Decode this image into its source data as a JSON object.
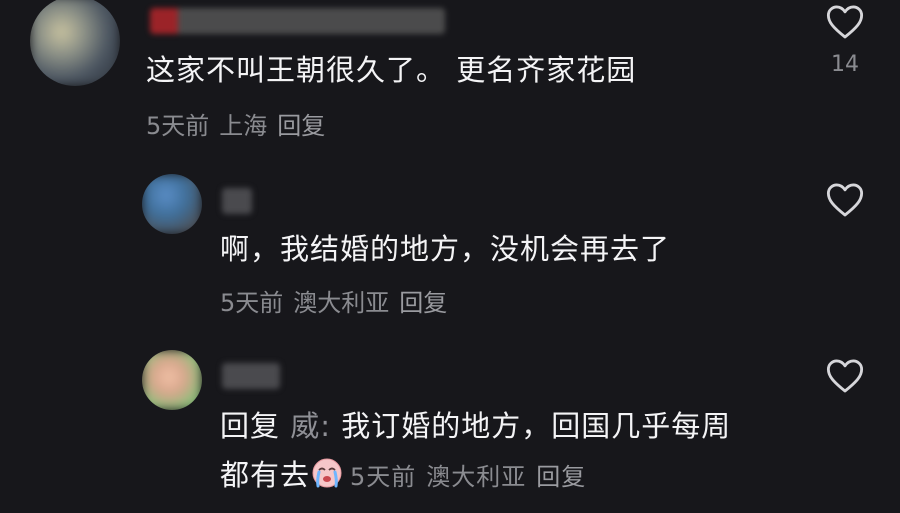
{
  "comments": [
    {
      "text": "这家不叫王朝很久了。 更名齐家花园",
      "meta": {
        "time": "5天前",
        "location": "上海",
        "reply_label": "回复"
      },
      "like_count": "14"
    },
    {
      "text": "啊，我结婚的地方，没机会再去了",
      "meta": {
        "time": "5天前",
        "location": "澳大利亚",
        "reply_label": "回复"
      }
    },
    {
      "reply_prefix": "回复",
      "reply_target": "威:",
      "text_line1": " 我订婚的地方，回国几乎每周",
      "text_line2": "都有去",
      "emoji": "crying-face-emoji",
      "meta": {
        "time": "5天前",
        "location": "澳大利亚",
        "reply_label": "回复"
      }
    }
  ],
  "colors": {
    "background": "#17171b",
    "text": "#f4f4f6",
    "meta": "#8a8b90"
  },
  "icons": {
    "like": "heart-outline-icon"
  }
}
